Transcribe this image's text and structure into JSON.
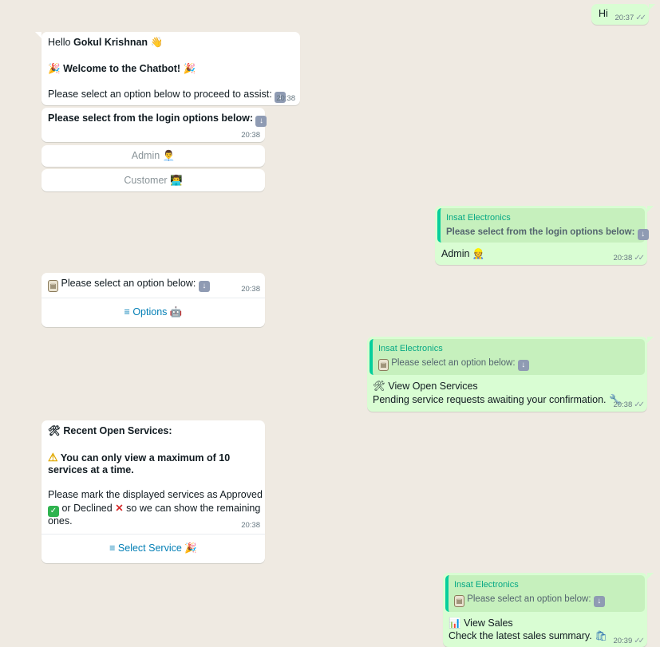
{
  "colors": {
    "chat_bg": "#efeae2",
    "incoming": "#ffffff",
    "outgoing": "#d9fdd3",
    "accent": "#06cf9c",
    "link": "#027eb5"
  },
  "msg1": {
    "text": "Hi",
    "time": "20:37"
  },
  "msg2": {
    "hello": "Hello",
    "name": "Gokul Krishnan",
    "welcome": "Welcome to the Chatbot!",
    "prompt": "Please select an option below to proceed to assist:",
    "time": "20:38"
  },
  "msg3": {
    "text": "Please select from the login options below:",
    "time": "20:38"
  },
  "login_buttons": {
    "admin": "Admin",
    "customer": "Customer"
  },
  "msg4": {
    "quote_name": "Insat Electronics",
    "quote_text": "Please select from the login options below:",
    "text": "Admin",
    "time": "20:38"
  },
  "msg5": {
    "text": "Please select an option below:",
    "time": "20:38",
    "button": "Options"
  },
  "msg6": {
    "quote_name": "Insat Electronics",
    "quote_text": "Please select an option below:",
    "title": "View Open Services",
    "desc": "Pending service requests awaiting your confirmation.",
    "time": "20:38"
  },
  "msg7": {
    "title": "Recent Open Services:",
    "warn1": "You can only view a maximum of 10",
    "warn2": "services at a time.",
    "p1": "Please mark the displayed services as Approved",
    "p2a": "or Declined",
    "p2b": "so we can show the remaining",
    "p3": "ones.",
    "time": "20:38",
    "button": "Select Service"
  },
  "msg8": {
    "quote_name": "Insat Electronics",
    "quote_text": "Please select an option below:",
    "title": "View Sales",
    "desc": "Check the latest sales summary.",
    "time": "20:39"
  }
}
